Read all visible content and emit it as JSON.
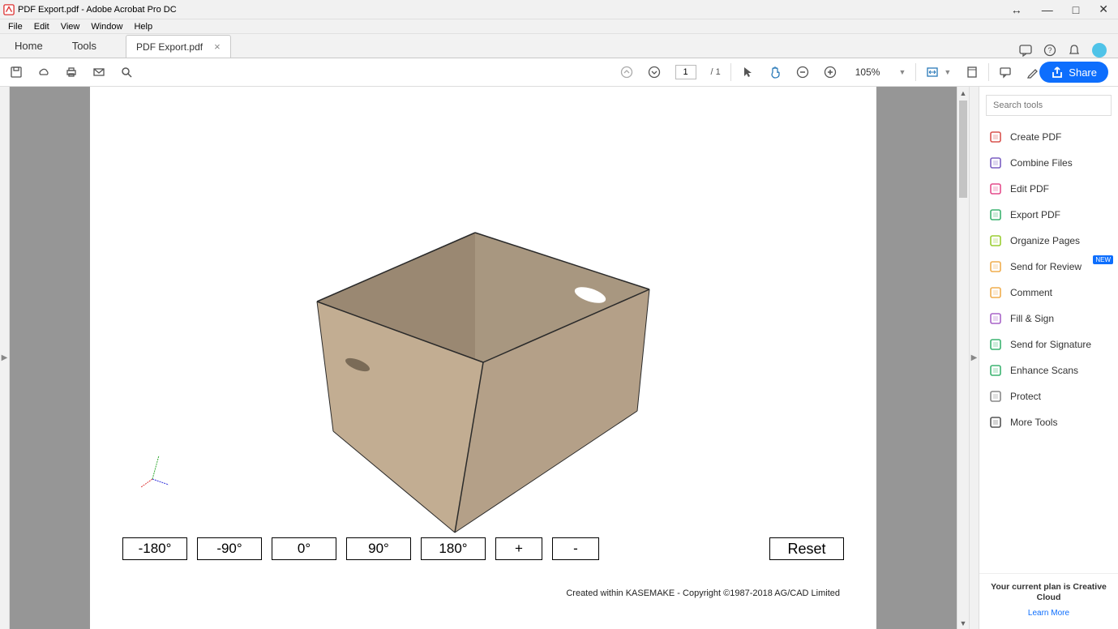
{
  "window": {
    "title": "PDF Export.pdf - Adobe Acrobat Pro DC"
  },
  "menubar": [
    "File",
    "Edit",
    "View",
    "Window",
    "Help"
  ],
  "tabs": {
    "home": "Home",
    "tools": "Tools",
    "document": "PDF Export.pdf"
  },
  "toolbar": {
    "page_current": "1",
    "page_total": "/ 1",
    "zoom": "105%",
    "share": "Share"
  },
  "pdf": {
    "buttons": [
      "-180°",
      "-90°",
      "0°",
      "90°",
      "180°",
      "+",
      "-"
    ],
    "reset": "Reset",
    "credit": "Created within KASEMAKE - Copyright ©1987-2018 AG/CAD Limited"
  },
  "sidebar": {
    "search_placeholder": "Search tools",
    "tools": [
      {
        "label": "Create PDF",
        "color": "#d9534f"
      },
      {
        "label": "Combine Files",
        "color": "#7b5fc2"
      },
      {
        "label": "Edit PDF",
        "color": "#e44c8c"
      },
      {
        "label": "Export PDF",
        "color": "#3cb371"
      },
      {
        "label": "Organize Pages",
        "color": "#9acd32"
      },
      {
        "label": "Send for Review",
        "color": "#f0ad4e",
        "badge": "NEW"
      },
      {
        "label": "Comment",
        "color": "#f0ad4e"
      },
      {
        "label": "Fill & Sign",
        "color": "#a864c8"
      },
      {
        "label": "Send for Signature",
        "color": "#3cb371"
      },
      {
        "label": "Enhance Scans",
        "color": "#3cb371"
      },
      {
        "label": "Protect",
        "color": "#888"
      },
      {
        "label": "More Tools",
        "color": "#555"
      }
    ]
  },
  "plan": {
    "text": "Your current plan is Creative Cloud",
    "link": "Learn More"
  }
}
